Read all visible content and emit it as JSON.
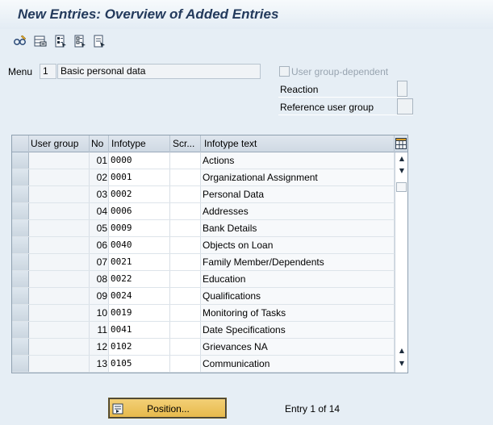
{
  "window": {
    "title": "New Entries: Overview of Added Entries"
  },
  "toolbar": {
    "icons": [
      "glasses-edit-icon",
      "delete-row-icon",
      "select-all-icon",
      "deselect-all-icon",
      "select-block-icon"
    ]
  },
  "header": {
    "menu_label": "Menu",
    "menu_value": "1",
    "menu_text": "Basic personal data",
    "user_group_dependent_label": "User group-dependent",
    "user_group_dependent_checked": false,
    "reaction_label": "Reaction",
    "reference_user_group_label": "Reference user group"
  },
  "table": {
    "columns": [
      "User group",
      "No",
      "Infotype",
      "Scr...",
      "Infotype text"
    ],
    "rows": [
      {
        "user_group": "",
        "no": "01",
        "infotype": "0000",
        "screen": "",
        "text": "Actions"
      },
      {
        "user_group": "",
        "no": "02",
        "infotype": "0001",
        "screen": "",
        "text": "Organizational Assignment"
      },
      {
        "user_group": "",
        "no": "03",
        "infotype": "0002",
        "screen": "",
        "text": "Personal Data"
      },
      {
        "user_group": "",
        "no": "04",
        "infotype": "0006",
        "screen": "",
        "text": "Addresses"
      },
      {
        "user_group": "",
        "no": "05",
        "infotype": "0009",
        "screen": "",
        "text": "Bank Details"
      },
      {
        "user_group": "",
        "no": "06",
        "infotype": "0040",
        "screen": "",
        "text": "Objects on Loan"
      },
      {
        "user_group": "",
        "no": "07",
        "infotype": "0021",
        "screen": "",
        "text": "Family Member/Dependents"
      },
      {
        "user_group": "",
        "no": "08",
        "infotype": "0022",
        "screen": "",
        "text": "Education"
      },
      {
        "user_group": "",
        "no": "09",
        "infotype": "0024",
        "screen": "",
        "text": "Qualifications"
      },
      {
        "user_group": "",
        "no": "10",
        "infotype": "0019",
        "screen": "",
        "text": "Monitoring of Tasks"
      },
      {
        "user_group": "",
        "no": "11",
        "infotype": "0041",
        "screen": "",
        "text": "Date Specifications"
      },
      {
        "user_group": "",
        "no": "12",
        "infotype": "0102",
        "screen": "",
        "text": "Grievances NA"
      },
      {
        "user_group": "",
        "no": "13",
        "infotype": "0105",
        "screen": "",
        "text": "Communication"
      }
    ]
  },
  "footer": {
    "position_button_label": "Position...",
    "entry_status": "Entry 1 of 14"
  },
  "colors": {
    "title_text": "#233a5c",
    "background": "#e6eef5",
    "position_button": "#e9bf52"
  }
}
